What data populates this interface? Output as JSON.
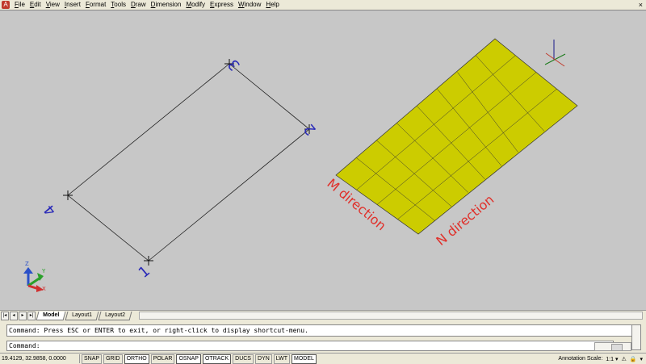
{
  "menu": {
    "items": [
      "File",
      "Edit",
      "View",
      "Insert",
      "Format",
      "Tools",
      "Draw",
      "Dimension",
      "Modify",
      "Express",
      "Window",
      "Help"
    ],
    "close": "×"
  },
  "drawing": {
    "point_labels": [
      "1",
      "2",
      "3",
      "4"
    ],
    "m_direction": "M direction",
    "n_direction": "N direction",
    "ucs_axes": [
      "Z",
      "Y",
      "X"
    ],
    "colors": {
      "background": "#c7c7c7",
      "surface": "#cccc00",
      "direction_text": "#e0302a",
      "point_text": "#2a2ab8"
    }
  },
  "tabs": {
    "nav": [
      "|◂",
      "◂",
      "▸",
      "▸|"
    ],
    "items": [
      "Model",
      "Layout1",
      "Layout2"
    ],
    "active": "Model"
  },
  "command": {
    "history": "Command: Press ESC or ENTER to exit, or right-click to display shortcut-menu.",
    "prompt": "Command:"
  },
  "status": {
    "coords": "19.4129, 32.9858, 0.0000",
    "modes": [
      "SNAP",
      "GRID",
      "ORTHO",
      "POLAR",
      "OSNAP",
      "OTRACK",
      "DUCS",
      "DYN",
      "LWT",
      "MODEL"
    ],
    "annotation_scale_label": "Annotation Scale:",
    "annotation_scale_value": "1:1 ▾"
  }
}
